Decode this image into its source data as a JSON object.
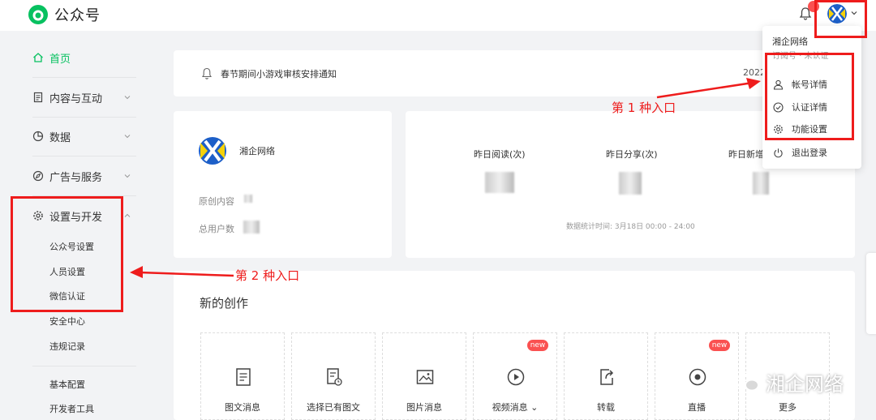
{
  "header": {
    "title": "公众号"
  },
  "sidebar": {
    "home": "首页",
    "content": "内容与互动",
    "data": "数据",
    "ads": "广告与服务",
    "settings": "设置与开发",
    "sub": [
      "公众号设置",
      "人员设置",
      "微信认证",
      "安全中心",
      "违规记录"
    ],
    "sub2": [
      "基本配置",
      "开发者工具"
    ]
  },
  "notice": {
    "text": "春节期间小游戏审核安排通知",
    "date": "2022"
  },
  "account": {
    "name": "湘企网络",
    "original_label": "原创内容",
    "users_label": "总用户数"
  },
  "stats": {
    "labels": [
      "昨日阅读(次)",
      "昨日分享(次)",
      "昨日新增"
    ],
    "note": "数据统计时间: 3月18日 00:00 - 24:00"
  },
  "create": {
    "title": "新的创作",
    "items": [
      "图文消息",
      "选择已有图文",
      "图片消息",
      "视频消息",
      "转载",
      "直播",
      "更多"
    ],
    "new_badge": "new"
  },
  "dropdown": {
    "name": "湘企网络",
    "sub": "订阅号 · 未认证",
    "items": [
      "帐号详情",
      "认证详情",
      "功能设置",
      "退出登录"
    ]
  },
  "annotations": {
    "entry1": "第 1 种入口",
    "entry2": "第 2 种入口"
  },
  "watermark": "湘企网络",
  "colors": {
    "accent": "#07c160",
    "annotation": "#ee1c1c"
  }
}
